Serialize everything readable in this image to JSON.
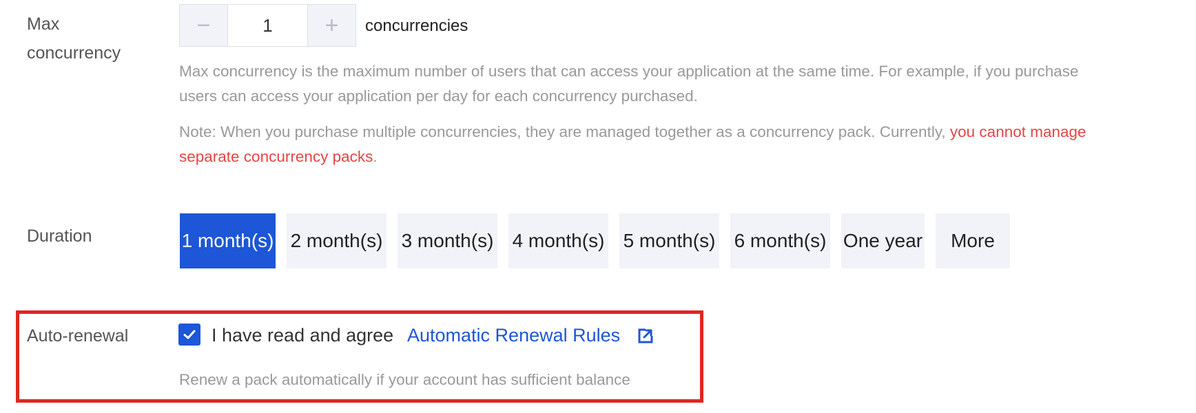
{
  "concurrency": {
    "label_line1": "Max",
    "label_line2": "concurrency",
    "decrement_symbol": "−",
    "value": "1",
    "increment_symbol": "+",
    "unit": "concurrencies",
    "description_line1": "Max concurrency is the maximum number of users that can access your application at the same time. For example, if you purchase",
    "description_line2": "users can access your application per day for each concurrency purchased.",
    "note_prefix": "Note: When you purchase multiple concurrencies, they are managed together as a concurrency pack. Currently, ",
    "note_warning_line1": "you cannot manage",
    "note_warning_line2": "separate concurrency packs",
    "note_suffix": "."
  },
  "duration": {
    "label": "Duration",
    "selected": "1 month(s)",
    "options": [
      "1 month(s)",
      "2 month(s)",
      "3 month(s)",
      "4 month(s)",
      "5 month(s)",
      "6 month(s)",
      "One year",
      "More"
    ]
  },
  "auto_renewal": {
    "label": "Auto-renewal",
    "checked": true,
    "agree_text": "I have read and agree",
    "rules_link": "Automatic Renewal Rules",
    "note": "Renew a pack automatically if your account has sufficient balance",
    "icons": [
      "check-icon",
      "external-link-icon"
    ]
  },
  "colors": {
    "accent": "#1d56d6",
    "warning": "#e54545",
    "highlight_border": "#e0261f",
    "muted_text": "#999999"
  }
}
